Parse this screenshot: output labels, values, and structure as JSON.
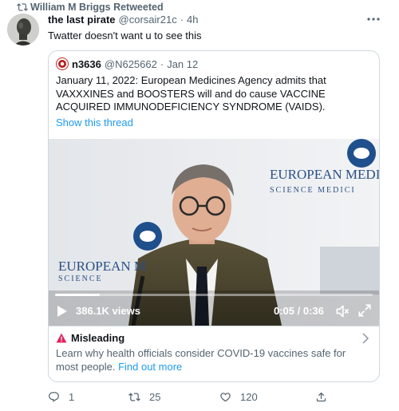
{
  "retweet": {
    "icon": "retweet-icon",
    "text": "William M Briggs Retweeted"
  },
  "author": {
    "name": "the last pirate",
    "handle": "@corsair21c",
    "separator": "·",
    "time": "4h",
    "avatar_icon": "statue-avatar"
  },
  "more_icon": "more-icon",
  "tweet_text": "Twatter doesn't want u to see this",
  "quoted": {
    "author": {
      "name": "n3636",
      "handle": "@N625662",
      "separator": "·",
      "time": "Jan 12",
      "avatar_icon": "red-avatar"
    },
    "text": "January 11, 2022: European Medicines Agency admits that VAXXXINES and BOOSTERS will and do cause VACCINE ACQUIRED IMMUNODEFICIENCY SYNDROME (VAIDS).",
    "show_thread": "Show this thread",
    "video": {
      "backdrop_text_1": "EUROPEAN MEDIC",
      "backdrop_text_2": "SCIENCE   MEDICI",
      "backdrop_text_3": "EUROPEAN M",
      "backdrop_text_4": "SCIENCE",
      "views": "386.1K views",
      "timecode": "0:05 / 0:36",
      "progress": 0.14
    },
    "misleading": {
      "title": "Misleading",
      "text": "Learn why health officials consider COVID-19 vaccines safe for most people.",
      "link": "Find out more"
    }
  },
  "actions": {
    "reply": {
      "icon": "reply-icon",
      "count": "1"
    },
    "retweet": {
      "icon": "retweet-icon",
      "count": "25"
    },
    "like": {
      "icon": "heart-icon",
      "count": "120"
    },
    "share": {
      "icon": "share-icon"
    }
  },
  "colors": {
    "accent": "#1d9bf0",
    "secondary_text": "#536471",
    "warning": "#e0245e",
    "border": "#cfd9de"
  }
}
